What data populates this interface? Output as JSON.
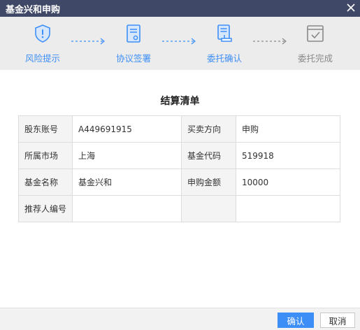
{
  "window": {
    "title": "基金兴和申购",
    "close_icon": "close-icon"
  },
  "steps": [
    {
      "label": "风险提示",
      "icon": "shield-icon",
      "state": "active"
    },
    {
      "label": "协议签署",
      "icon": "document-icon",
      "state": "active"
    },
    {
      "label": "委托确认",
      "icon": "stamp-icon",
      "state": "active"
    },
    {
      "label": "委托完成",
      "icon": "checkbox-icon",
      "state": "pending"
    }
  ],
  "summary": {
    "title": "结算清单",
    "rows": [
      {
        "k1": "股东账号",
        "v1": "A449691915",
        "k2": "买卖方向",
        "v2": "申购"
      },
      {
        "k1": "所属市场",
        "v1": "上海",
        "k2": "基金代码",
        "v2": "519918"
      },
      {
        "k1": "基金名称",
        "v1": "基金兴和",
        "k2": "申购金额",
        "v2": "10000"
      },
      {
        "k1": "推荐人编号",
        "v1": "",
        "k2": "",
        "v2": ""
      }
    ]
  },
  "footer": {
    "confirm_label": "确认",
    "cancel_label": "取消"
  },
  "colors": {
    "titlebar": "#3f4866",
    "accent": "#3d8ef7",
    "inactive": "#888888"
  }
}
